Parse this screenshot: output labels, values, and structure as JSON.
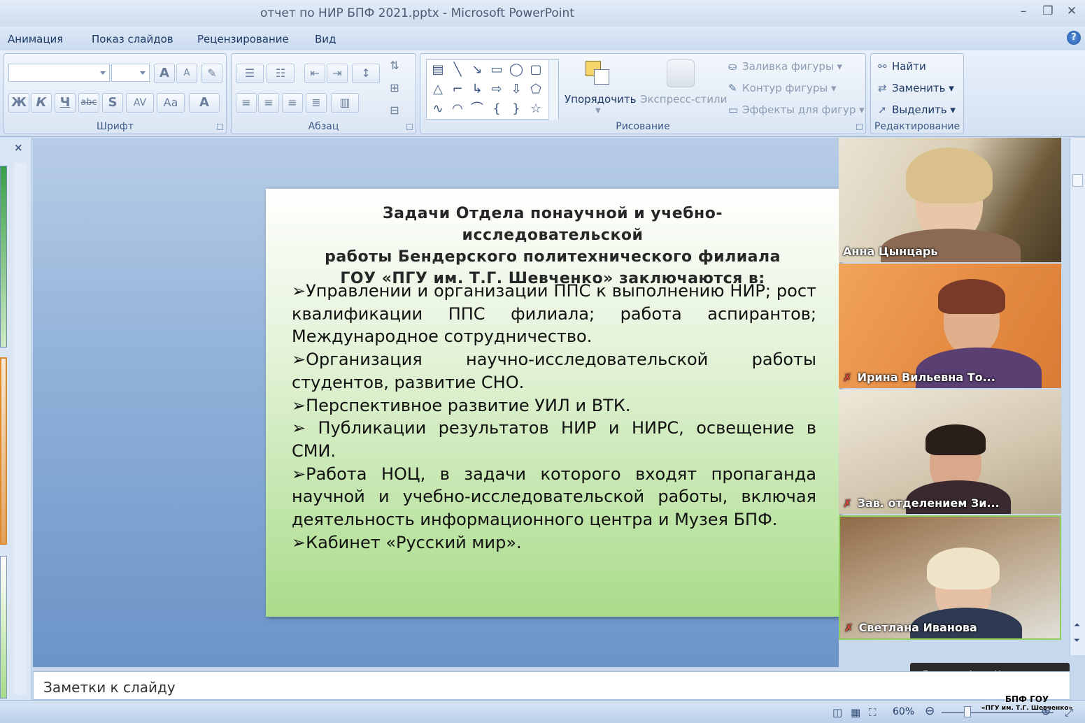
{
  "window": {
    "title": "отчет по НИР БПФ 2021.pptx - Microsoft PowerPoint",
    "minimize": "–",
    "maximize": "❐",
    "close": "✕"
  },
  "tabs": [
    "Анимация",
    "Показ слайдов",
    "Рецензирование",
    "Вид"
  ],
  "ribbon": {
    "groups": {
      "font": "Шрифт",
      "paragraph": "Абзац",
      "drawing": "Рисование",
      "editing": "Редактирование"
    },
    "font_buttons": [
      "Ж",
      "К",
      "Ч",
      "abc",
      "S",
      "AV",
      "Aa",
      "A"
    ],
    "grow_font": "A",
    "shrink_font": "A",
    "arrange": "Упорядочить",
    "quick_styles": "Экспресс-стили",
    "shape_fill": "Заливка фигуры",
    "shape_outline": "Контур фигуры",
    "shape_effects": "Эффекты для фигур",
    "find": "Найти",
    "replace": "Заменить",
    "select": "Выделить"
  },
  "slide": {
    "title": "Задачи Отдела понаучной и учебно-исследовательской\nработы Бендерского политехнического филиала\nГОУ «ПГУ им. Т.Г. Шевченко» заключаются в:",
    "bullets": [
      "Управлении и организации ППС к  выполнению НИР; рост квалификации ППС филиала; работа аспирантов; Международное сотрудничество.",
      "Организация научно-исследовательской работы студентов, развитие СНО.",
      "Перспективное развитие УИЛ и ВТК.",
      " Публикации результатов НИР и НИРС, освещение в СМИ.",
      "Работа НОЦ, в задачи которого входят пропаганда научной и учебно-исследовательской работы, включая деятельность информационного центра и Музея БПФ.",
      "Кабинет «Русский мир»."
    ]
  },
  "notes_placeholder": "Заметки к слайду",
  "participants": [
    {
      "name": "Анна Цынцарь",
      "muted": false
    },
    {
      "name": "Ирина Вильевна То...",
      "muted": true
    },
    {
      "name": "Зав. отделением Зи...",
      "muted": true
    },
    {
      "name": "Светлана Иванова",
      "muted": true
    }
  ],
  "speaking_tooltip": "Говорит: Анна Цынцарь",
  "status": {
    "zoom": "60%"
  },
  "watermark": {
    "line1": "БПФ ГОУ",
    "line2": "«ПГУ им. Т.Г. Шевченко»"
  },
  "colors": {
    "ribbon": "#dde8f6",
    "slide_gradient_end": "#a9dc8a",
    "active_speaker_border": "#8fcf5c",
    "muted_mic": "#e0483a"
  }
}
